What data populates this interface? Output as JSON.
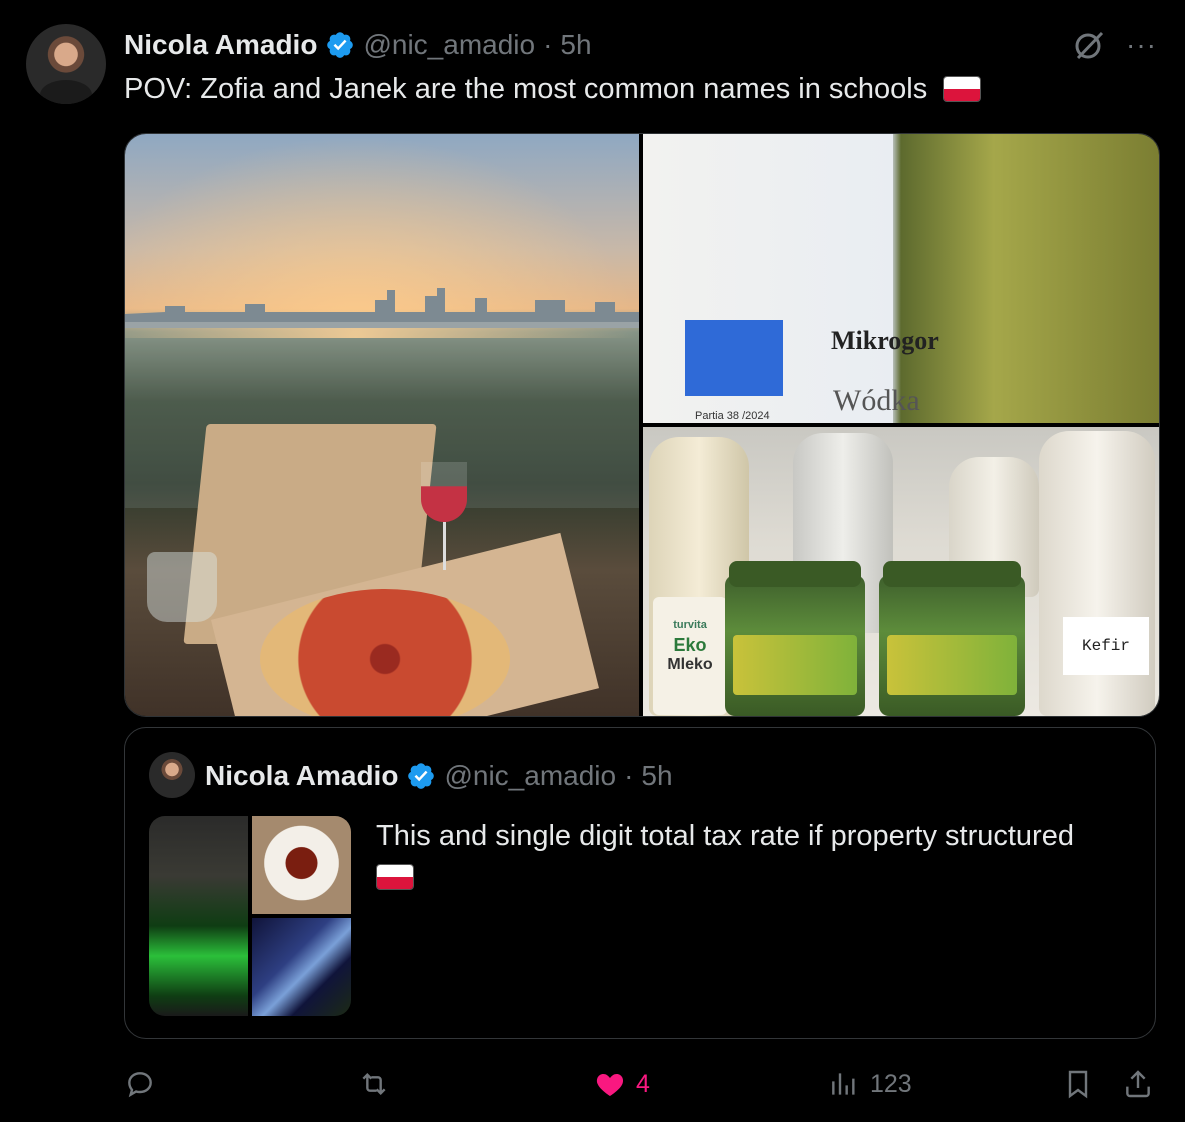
{
  "post": {
    "author_name": "Nicola Amadio",
    "handle": "@nic_amadio",
    "separator": "·",
    "time": "5h",
    "text": "POV: Zofia and Janek are the most common names in schools",
    "flag_emoji": "poland-flag",
    "more_label": "···"
  },
  "media": {
    "bottle_brand": "Mikrogor",
    "bottle_type": "Wódka",
    "batch_label": "Partia 38 /2024",
    "milk_brand": "turvita",
    "milk_label_top": "Eko",
    "milk_label_bottom": "Mleko",
    "kefir_label": "Kefir"
  },
  "quote": {
    "author_name": "Nicola Amadio",
    "handle": "@nic_amadio",
    "separator": "·",
    "time": "5h",
    "text": "This and single digit total tax rate if property structured"
  },
  "actions": {
    "reply_count": "",
    "repost_count": "",
    "like_count": "4",
    "views_count": "123"
  },
  "colors": {
    "background": "#000000",
    "text": "#e7e9ea",
    "muted": "#71767b",
    "verified": "#1d9bf0",
    "like": "#f91880"
  }
}
